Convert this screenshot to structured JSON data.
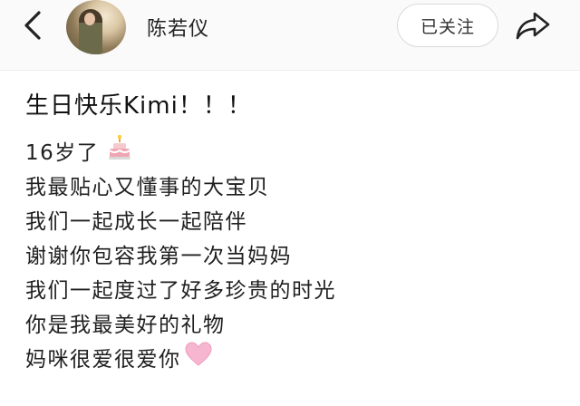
{
  "header": {
    "username": "陈若仪",
    "follow_label": "已关注"
  },
  "post": {
    "title": "生日快乐Kimi！！！",
    "lines": [
      {
        "text": "16岁了",
        "emoji": "cake-icon"
      },
      {
        "text": "我最贴心又懂事的大宝贝"
      },
      {
        "text": "我们一起成长一起陪伴"
      },
      {
        "text": "谢谢你包容我第一次当妈妈"
      },
      {
        "text": "我们一起度过了好多珍贵的时光"
      },
      {
        "text": "你是我最美好的礼物"
      },
      {
        "text": "妈咪很爱很爱你",
        "emoji": "pink-heart-icon"
      }
    ]
  },
  "colors": {
    "header_bg": "#fafafa",
    "heart_pink": "#f7b6cf",
    "cake_frosting": "#f6c9cf"
  }
}
